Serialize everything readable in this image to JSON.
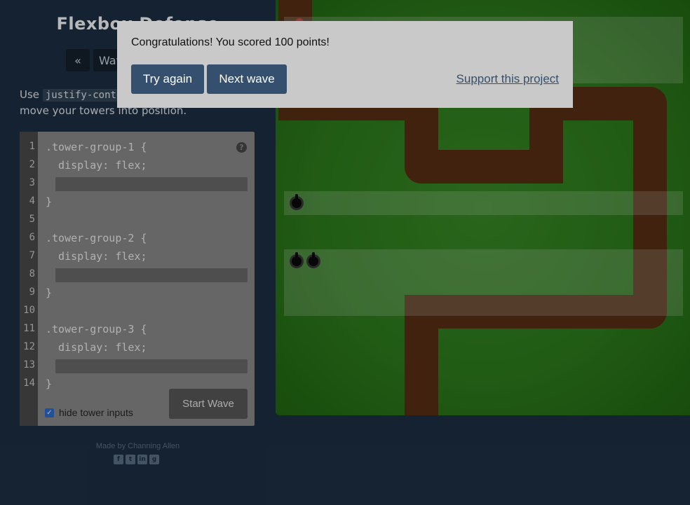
{
  "app": {
    "title": "Flexbox Defense"
  },
  "nav": {
    "prev_label": "«",
    "wave_label": "Wave 11 of 12"
  },
  "instructions": {
    "prefix": "Use",
    "property": "justify-content",
    "suffix": "and align-items to move your towers into position."
  },
  "editor": {
    "lines": [
      {
        "no": "1",
        "code": ".tower-group-1 {"
      },
      {
        "no": "2",
        "code": "  display: flex;"
      },
      {
        "no": "3",
        "code": ""
      },
      {
        "no": "4",
        "code": "}"
      },
      {
        "no": "5",
        "code": ""
      },
      {
        "no": "6",
        "code": ".tower-group-2 {"
      },
      {
        "no": "7",
        "code": "  display: flex;"
      },
      {
        "no": "8",
        "code": ""
      },
      {
        "no": "9",
        "code": "}"
      },
      {
        "no": "10",
        "code": ""
      },
      {
        "no": "11",
        "code": ".tower-group-3 {"
      },
      {
        "no": "12",
        "code": "  display: flex;"
      },
      {
        "no": "13",
        "code": ""
      },
      {
        "no": "14",
        "code": "}"
      }
    ],
    "input_values": [
      "",
      "",
      ""
    ],
    "help_icon": "?",
    "start_wave_label": "Start Wave",
    "hide_inputs_label": "hide tower inputs",
    "hide_inputs_checked": true
  },
  "footer": {
    "credit": "Made by Channing Allen",
    "social_icons": [
      "facebook-icon",
      "twitter-icon",
      "linkedin-icon",
      "github-icon"
    ]
  },
  "modal": {
    "message": "Congratulations! You scored 100 points!",
    "try_again_label": "Try again",
    "next_wave_label": "Next wave",
    "support_label": "Support this project"
  },
  "colors": {
    "page_bg": "#1d3045",
    "board_green": "#2f801d",
    "path_brown": "#5a3014",
    "button_blue": "#34506e"
  }
}
